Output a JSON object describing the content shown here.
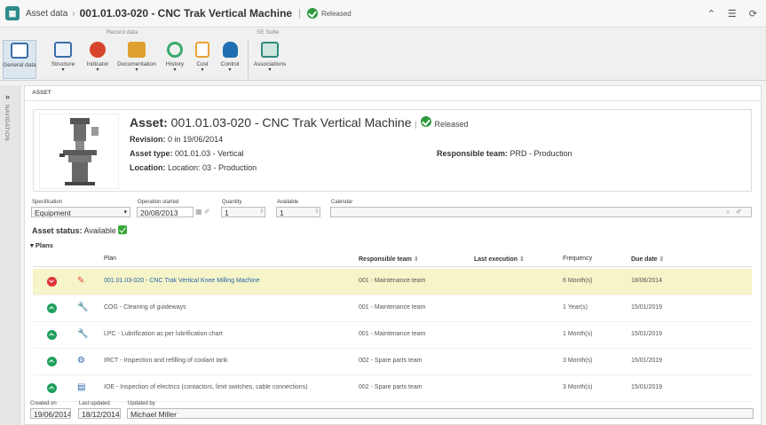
{
  "header": {
    "breadcrumb_root": "Asset data",
    "separator": "›",
    "title": "001.01.03-020 - CNC Trak Vertical Machine",
    "pipe": "|",
    "status": "Released"
  },
  "ribbon": {
    "group_record": "Record data",
    "group_se": "SE Suite",
    "buttons": [
      {
        "label": "General data",
        "icon": "general-data-icon",
        "color": "#3b6ea8"
      },
      {
        "label": "Structure",
        "icon": "structure-icon",
        "color": "#3b6ea8"
      },
      {
        "label": "Indicator",
        "icon": "indicator-icon",
        "color": "#d8432b"
      },
      {
        "label": "Documentation",
        "icon": "folder-icon",
        "color": "#e0a030"
      },
      {
        "label": "History",
        "icon": "history-icon",
        "color": "#3aa86a"
      },
      {
        "label": "Cost",
        "icon": "cost-icon",
        "color": "#e8a33a"
      },
      {
        "label": "Control",
        "icon": "control-icon",
        "color": "#1f6fb2"
      },
      {
        "label": "Associations",
        "icon": "associations-icon",
        "color": "#2e8b7a"
      }
    ],
    "dropdown_glyph": "▾"
  },
  "nav": {
    "expand": "»",
    "label": "NAVIGATION"
  },
  "section": {
    "title": "ASSET"
  },
  "asset": {
    "prefix": "Asset:",
    "title": " 001.01.03-020 - CNC Trak Vertical Machine",
    "pipe": "|",
    "status": "Released",
    "revision_label": "Revision:",
    "revision_value": "0 in 19/06/2014",
    "type_label": "Asset type:",
    "type_value": "001.01.03 - Vertical",
    "location_label": "Location:",
    "location_value": "Location: 03 - Production",
    "team_label": "Responsible team:",
    "team_value": "PRD - Production"
  },
  "fields": {
    "spec_label": "Specification",
    "spec_value": "Equipment",
    "op_label": "Operation started",
    "op_value": "20/08/2013",
    "qty_label": "Quantity",
    "qty_value": "1",
    "avail_label": "Available",
    "avail_value": "1",
    "cal_label": "Calendar",
    "cal_value": ""
  },
  "asset_status": {
    "label": "Asset status:",
    "value": "Available"
  },
  "plans": {
    "title": "Plans",
    "columns": {
      "plan": "Plan",
      "team": "Responsible team",
      "last": "Last execution",
      "freq": "Frequency",
      "due": "Due date",
      "sort": "⇕"
    },
    "rows": [
      {
        "status": "red",
        "icon": "✎",
        "icon_color": "#e04a2a",
        "plan": "001.01.03-020 - CNC Trak Vertical Knee Milling Machine",
        "team": "001 - Maintenance team",
        "last": "",
        "freq": "6 Month(s)",
        "due": "18/06/2014"
      },
      {
        "status": "green",
        "icon": "🔧",
        "icon_color": "#2a64a8",
        "plan": "COG - Cleaning of guideways",
        "team": "001 - Maintenance team",
        "last": "",
        "freq": "1 Year(s)",
        "due": "15/01/2019"
      },
      {
        "status": "green",
        "icon": "🔧",
        "icon_color": "#2a64a8",
        "plan": "LPC - Lubrification as per lubrification chart",
        "team": "001 - Maintenance team",
        "last": "",
        "freq": "1 Month(s)",
        "due": "15/01/2019"
      },
      {
        "status": "green",
        "icon": "⚙",
        "icon_color": "#2a64a8",
        "plan": "IRCT - Inspection and refilling of coolant tank",
        "team": "002 - Spare parts team",
        "last": "",
        "freq": "3 Month(s)",
        "due": "15/01/2019"
      },
      {
        "status": "green",
        "icon": "▤",
        "icon_color": "#2a64a8",
        "plan": "IOE - Inspection of electrics (contactors, limit switches, cable connections)",
        "team": "002 - Spare parts team",
        "last": "",
        "freq": "3 Month(s)",
        "due": "15/01/2019"
      }
    ]
  },
  "footer": {
    "created_label": "Created on",
    "created_value": "19/06/2014",
    "updated_label": "Last updated",
    "updated_value": "18/12/2014",
    "by_label": "Updated by",
    "by_value": "Michael Miller"
  }
}
